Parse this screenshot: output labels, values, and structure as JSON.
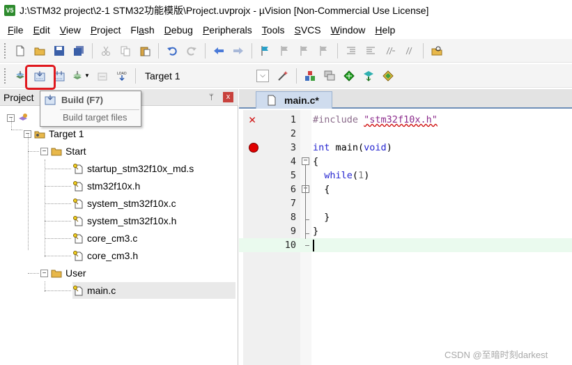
{
  "window": {
    "title": "J:\\STM32 project\\2-1 STM32功能模版\\Project.uvprojx - µVision  [Non-Commercial Use License]"
  },
  "menu": [
    {
      "hot": "F",
      "rest": "ile"
    },
    {
      "hot": "E",
      "rest": "dit"
    },
    {
      "hot": "V",
      "rest": "iew"
    },
    {
      "hot": "P",
      "rest": "roject"
    },
    {
      "pre": "Fl",
      "hot": "a",
      "rest": "sh"
    },
    {
      "hot": "D",
      "rest": "ebug"
    },
    {
      "hot": "P",
      "rest": "eripherals"
    },
    {
      "hot": "T",
      "rest": "ools"
    },
    {
      "hot": "S",
      "rest": "VCS"
    },
    {
      "hot": "W",
      "rest": "indow"
    },
    {
      "hot": "H",
      "rest": "elp"
    }
  ],
  "build_toolbar": {
    "target": "Target 1",
    "load_label": "LOAD"
  },
  "tooltip": {
    "title": "Build (F7)",
    "description": "Build target files"
  },
  "project_pane": {
    "title": "Project",
    "pin": "ᛘ",
    "close": "x",
    "tree": {
      "target": "Target 1",
      "groups": [
        {
          "name": "Start",
          "files": [
            "startup_stm32f10x_md.s",
            "stm32f10x.h",
            "system_stm32f10x.c",
            "system_stm32f10x.h",
            "core_cm3.c",
            "core_cm3.h"
          ]
        },
        {
          "name": "User",
          "files": [
            "main.c"
          ]
        }
      ]
    }
  },
  "editor": {
    "tab": "main.c*",
    "lines": [
      {
        "n": "1"
      },
      {
        "n": "2"
      },
      {
        "n": "3"
      },
      {
        "n": "4"
      },
      {
        "n": "5"
      },
      {
        "n": "6"
      },
      {
        "n": "7"
      },
      {
        "n": "8"
      },
      {
        "n": "9"
      },
      {
        "n": "10"
      }
    ],
    "code": {
      "include_kw": "#include",
      "include_file": "\"stm32f10x.h\"",
      "int_kw": "int",
      "main_name": " main(",
      "void_kw": "void",
      "close_paren": ")",
      "open_brace": "{",
      "while_kw": "while",
      "while_open": "(",
      "while_arg": "1",
      "while_close": ")",
      "inner_open": "{",
      "inner_close": "}",
      "outer_close": "}"
    }
  },
  "watermark": "CSDN @至暗时刻darkest",
  "colors": {
    "highlight": "#e0181e",
    "keyword": "#2424d0",
    "current_line": "#eafaee"
  }
}
